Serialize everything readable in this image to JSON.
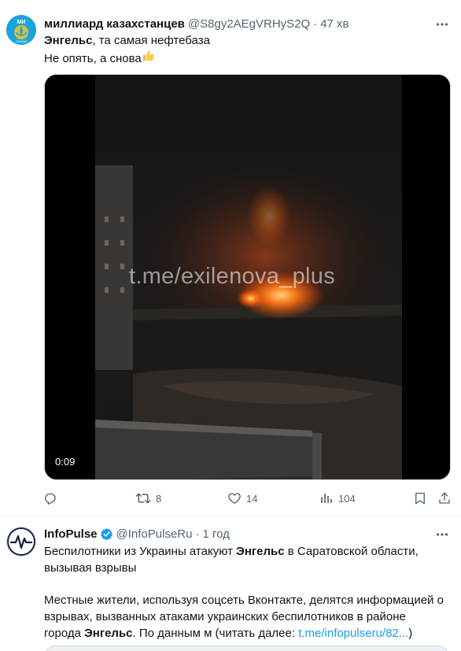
{
  "tweet1": {
    "author_name": "миллиард казахстанцев",
    "author_handle": "@S8gy2AEgVRHyS2Q",
    "separator": "·",
    "time": "47 хв",
    "avatar_text_top": "МИ",
    "avatar_text_bottom": "З ВАМИ",
    "text_line1_bold": "Энгельс",
    "text_line1_rest": ", та самая нефтебаза",
    "text_line2": "Не опять, а снова",
    "text_line2_emoji": "👍",
    "video": {
      "watermark": "t.me/exilenova_plus",
      "duration": "0:09"
    },
    "actions": {
      "reply_count": "",
      "retweet_count": "8",
      "like_count": "14",
      "views_count": "104"
    }
  },
  "tweet2": {
    "author_name": "InfoPulse",
    "author_handle": "@InfoPulseRu",
    "separator": "·",
    "time": "1 год",
    "para1_line1_a": "Беспилотники из Украины атакуют ",
    "para1_line1_bold": "Энгельс",
    "para1_line1_b": " в Саратовской области,",
    "para1_line2": "вызывая взрывы",
    "para2_line1": "Местные жители, используя соцсеть Вконтакте, делятся информацией о",
    "para2_line2": "взрывах, вызванных атаками украинских беспилотников в районе",
    "para2_line3_a": "города ",
    "para2_line3_bold": "Энгельс",
    "para2_line3_b": ". По данным м (читать далее: ",
    "para2_link": "t.me/infopulseru/82...",
    "para2_line3_end": ")"
  },
  "colors": {
    "text": "#0f1419",
    "secondary": "#536471",
    "link": "#1d9bf0",
    "verified": "#1d9bf0",
    "fire": "#ff6a1a"
  }
}
